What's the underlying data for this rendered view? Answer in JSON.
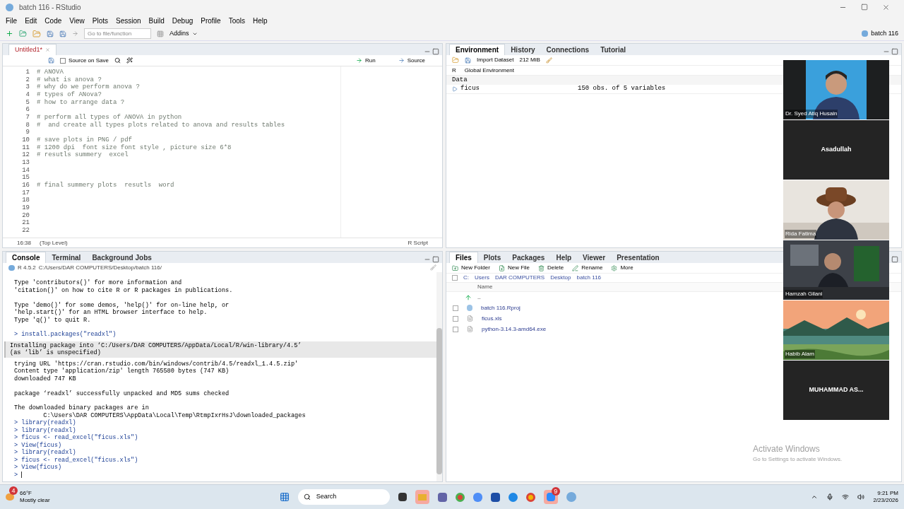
{
  "window": {
    "title": "batch 116 - RStudio"
  },
  "menu": [
    "File",
    "Edit",
    "Code",
    "View",
    "Plots",
    "Session",
    "Build",
    "Debug",
    "Profile",
    "Tools",
    "Help"
  ],
  "toolbar": {
    "goto_placeholder": "Go to file/function",
    "addins": "Addins",
    "project": "batch 116"
  },
  "editor": {
    "tabs": [
      {
        "label": "Untitled1*",
        "selected": true
      }
    ],
    "source_on_save": {
      "label": "Source on Save",
      "checked": false
    },
    "run": "Run",
    "source": "Source",
    "lines": [
      {
        "n": "1",
        "text": "# ANOVA"
      },
      {
        "n": "2",
        "text": "# what is anova ?"
      },
      {
        "n": "3",
        "text": "# why do we perform anova ?"
      },
      {
        "n": "4",
        "text": "# types of ANova?"
      },
      {
        "n": "5",
        "text": "# how to arrange data ?"
      },
      {
        "n": "6"
      },
      {
        "n": "7",
        "text": "# perform all types of ANOVA in python"
      },
      {
        "n": "8",
        "text": "#  and create all types plots related to anova and results tables"
      },
      {
        "n": "9"
      },
      {
        "n": "10",
        "text": "# save plots in PNG / pdf"
      },
      {
        "n": "11",
        "text": "# 1200 dpi  font size font style , picture size 6*8"
      },
      {
        "n": "12",
        "text": "# resutls summery  excel"
      },
      {
        "n": "13"
      },
      {
        "n": "14"
      },
      {
        "n": "15"
      },
      {
        "n": "16",
        "text": "# final summery plots  resutls  word "
      },
      {
        "n": "17"
      },
      {
        "n": "18"
      },
      {
        "n": "19"
      },
      {
        "n": "20"
      },
      {
        "n": "21"
      },
      {
        "n": "22"
      }
    ],
    "status": {
      "position": "16:38",
      "scope": "(Top Level)",
      "type": "R Script"
    }
  },
  "console": {
    "tabs": [
      {
        "label": "Console",
        "selected": true
      },
      {
        "label": "Terminal",
        "selected": false
      },
      {
        "label": "Background Jobs",
        "selected": false
      }
    ],
    "version": "R 4.5.2",
    "path": "C:/Users/DAR COMPUTERS/Desktop/batch 116/",
    "lines": [
      {
        "kind": "output",
        "text": "Type 'contributors()' for more information and"
      },
      {
        "kind": "output",
        "text": "'citation()' on how to cite R or R packages in publications."
      },
      {
        "kind": "blank"
      },
      {
        "kind": "output",
        "text": "Type 'demo()' for some demos, 'help()' for on-line help, or"
      },
      {
        "kind": "output",
        "text": "'help.start()' for an HTML browser interface to help."
      },
      {
        "kind": "output",
        "text": "Type 'q()' to quit R."
      },
      {
        "kind": "blank"
      },
      {
        "kind": "input",
        "text": "> install.packages(\"readxl\")"
      },
      {
        "kind": "message",
        "text": "Installing package into ‘C:/Users/DAR COMPUTERS/AppData/Local/R/win-library/4.5’\n(as ‘lib’ is unspecified)"
      },
      {
        "kind": "output",
        "text": "trying URL 'https://cran.rstudio.com/bin/windows/contrib/4.5/readxl_1.4.5.zip'"
      },
      {
        "kind": "output",
        "text": "Content type 'application/zip' length 765580 bytes (747 KB)"
      },
      {
        "kind": "output",
        "text": "downloaded 747 KB"
      },
      {
        "kind": "blank"
      },
      {
        "kind": "output",
        "text": "package ‘readxl’ successfully unpacked and MD5 sums checked"
      },
      {
        "kind": "blank"
      },
      {
        "kind": "output",
        "text": "The downloaded binary packages are in"
      },
      {
        "kind": "output",
        "text": "        C:\\Users\\DAR COMPUTERS\\AppData\\Local\\Temp\\RtmpIxrHsJ\\downloaded_packages"
      },
      {
        "kind": "input",
        "text": "> library(readxl)"
      },
      {
        "kind": "input",
        "text": "> library(readxl)"
      },
      {
        "kind": "input",
        "text": "> ficus <- read_excel(\"ficus.xls\")"
      },
      {
        "kind": "input",
        "text": "> View(ficus)"
      },
      {
        "kind": "input",
        "text": "> library(readxl)"
      },
      {
        "kind": "input",
        "text": "> ficus <- read_excel(\"ficus.xls\")"
      },
      {
        "kind": "input",
        "text": "> View(ficus)"
      },
      {
        "kind": "prompt",
        "text": ">"
      }
    ]
  },
  "environment": {
    "tabs": [
      {
        "label": "Environment",
        "selected": true
      },
      {
        "label": "History",
        "selected": false
      },
      {
        "label": "Connections",
        "selected": false
      },
      {
        "label": "Tutorial",
        "selected": false
      }
    ],
    "import": "Import Dataset",
    "memory": "212 MiB",
    "language": "R",
    "scope": "Global Environment",
    "section": "Data",
    "rows": [
      {
        "name": "ficus",
        "value": "150 obs. of 5 variables"
      }
    ]
  },
  "files": {
    "tabs": [
      {
        "label": "Files",
        "selected": true
      },
      {
        "label": "Plots",
        "selected": false
      },
      {
        "label": "Packages",
        "selected": false
      },
      {
        "label": "Help",
        "selected": false
      },
      {
        "label": "Viewer",
        "selected": false
      },
      {
        "label": "Presentation",
        "selected": false
      }
    ],
    "actions": [
      {
        "kind": "folder",
        "label": "New Folder"
      },
      {
        "kind": "file",
        "label": "New File"
      },
      {
        "kind": "delete",
        "label": "Delete"
      },
      {
        "kind": "rename",
        "label": "Rename"
      },
      {
        "kind": "more",
        "label": "More"
      }
    ],
    "select_all": {
      "checked": false
    },
    "breadcrumb": [
      "C:",
      "Users",
      "DAR COMPUTERS",
      "Desktop",
      "batch 116"
    ],
    "column": "Name",
    "up": "..",
    "entries": [
      {
        "name": "batch 116.Rproj",
        "kind": "project",
        "checked": false
      },
      {
        "name": "ficus.xls",
        "kind": "file",
        "checked": false
      },
      {
        "name": "python-3.14.3-amd64.exe",
        "kind": "file",
        "checked": false
      }
    ]
  },
  "participants": [
    {
      "name": "Dr. Syed Atiq Husain",
      "kind": "picture"
    },
    {
      "name": "Asadullah",
      "kind": "name"
    },
    {
      "name": "Rida Fatima",
      "kind": "picture"
    },
    {
      "name": "Hamzah Gilani",
      "kind": "picture"
    },
    {
      "name": "Habib Alam",
      "kind": "picture"
    },
    {
      "name": "MUHAMMAD AS...",
      "kind": "name"
    }
  ],
  "activation": {
    "title": "Activate Windows",
    "subtitle": "Go to Settings to activate Windows."
  },
  "taskbar": {
    "temperature": "66°F",
    "weather": "Mostly clear",
    "weather_badge": "4",
    "search": "Search",
    "zoom_badge": "9",
    "time": "9:21 PM",
    "date": "2/23/2026"
  }
}
